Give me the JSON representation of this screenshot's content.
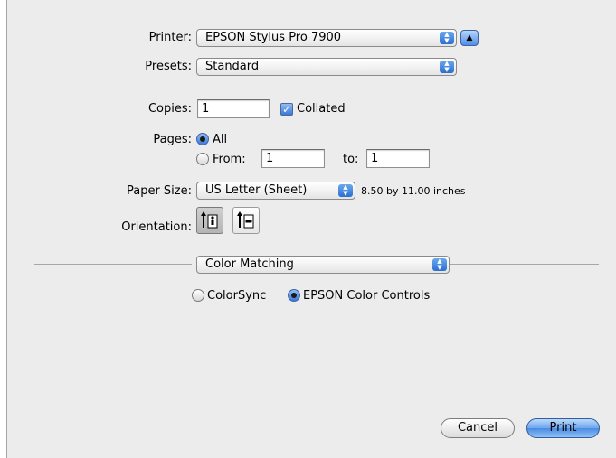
{
  "printer": {
    "label": "Printer:",
    "value": "EPSON Stylus Pro 7900"
  },
  "presets": {
    "label": "Presets:",
    "value": "Standard"
  },
  "copies": {
    "label": "Copies:",
    "value": "1",
    "collated_label": "Collated",
    "collated_checked": true
  },
  "pages": {
    "label": "Pages:",
    "all_label": "All",
    "from_label": "From:",
    "from_value": "1",
    "to_label": "to:",
    "to_value": "1",
    "selected": "all"
  },
  "paper_size": {
    "label": "Paper Size:",
    "value": "US Letter (Sheet)",
    "dimensions": "8.50 by 11.00 inches"
  },
  "orientation": {
    "label": "Orientation:",
    "selected": "portrait",
    "options": [
      "portrait-icon",
      "landscape-icon"
    ]
  },
  "panel": {
    "value": "Color Matching"
  },
  "color_mode": {
    "colorsync_label": "ColorSync",
    "epson_label": "EPSON Color Controls",
    "selected": "epson"
  },
  "buttons": {
    "cancel": "Cancel",
    "print": "Print"
  },
  "colors": {
    "accent": "#3b7ad9",
    "background": "#ececec"
  }
}
